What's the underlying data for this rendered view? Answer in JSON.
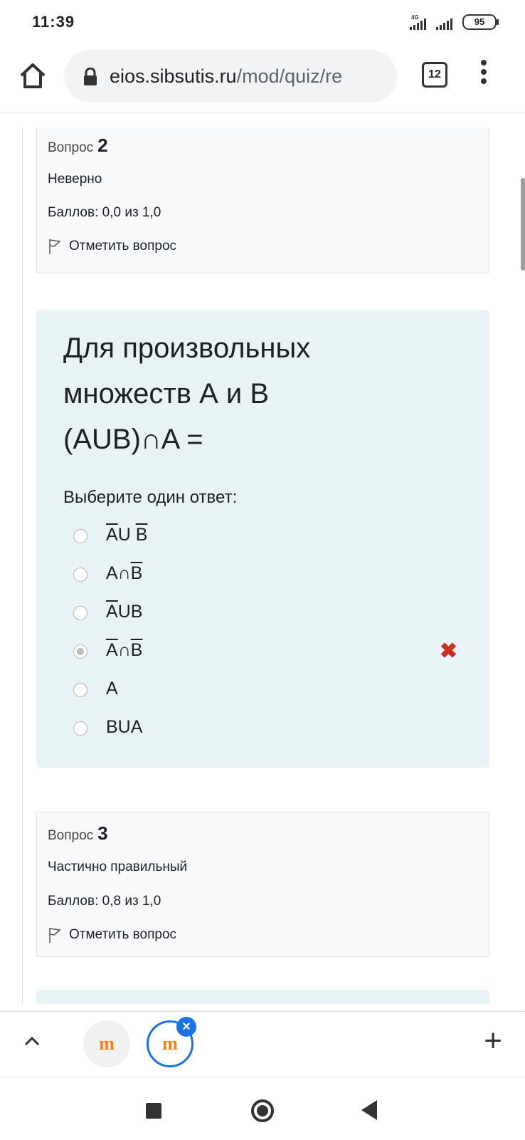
{
  "status": {
    "time": "11:39",
    "network": "4G",
    "battery": "95"
  },
  "browser": {
    "url_host": "eios.sibsutis.ru",
    "url_path": "/mod/quiz/re",
    "tab_count": "12"
  },
  "question2": {
    "label": "Вопрос",
    "number": "2",
    "state": "Неверно",
    "grade": "Баллов: 0,0 из 1,0",
    "flag": "Отметить вопрос"
  },
  "formulation": {
    "text_line1": "Для произвольных",
    "text_line2": "множеств А и В",
    "text_line3": "(AUB)∩A =",
    "prompt": "Выберите один ответ:",
    "answers": [
      {
        "parts": [
          "A",
          "U ",
          "B"
        ],
        "checked": false,
        "wrong": false
      },
      {
        "parts": [
          "A∩",
          "B"
        ],
        "checked": false,
        "wrong": false
      },
      {
        "parts": [
          "A",
          "UB"
        ],
        "checked": false,
        "wrong": false
      },
      {
        "parts": [
          "A",
          "∩",
          "B"
        ],
        "checked": true,
        "wrong": true
      },
      {
        "parts": [
          "A"
        ],
        "checked": false,
        "wrong": false
      },
      {
        "parts": [
          "BUA"
        ],
        "checked": false,
        "wrong": false
      }
    ],
    "wrong_mark": "✖"
  },
  "question3": {
    "label": "Вопрос",
    "number": "3",
    "state": "Частично правильный",
    "grade": "Баллов: 0,8 из 1,0",
    "flag": "Отметить вопрос"
  },
  "tabstrip": {
    "tab_logo": "m",
    "close_symbol": "×",
    "new_tab_symbol": "+"
  },
  "colors": {
    "formulation_bg": "#e7f3f5",
    "wrong": "#ca3120",
    "accent": "#1a73e8",
    "moodle_orange": "#f98012"
  }
}
